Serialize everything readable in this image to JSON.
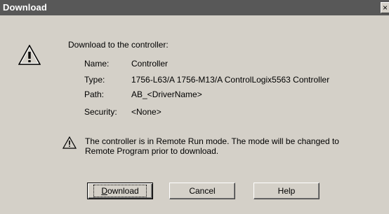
{
  "window": {
    "title": "Download",
    "close_glyph": "×"
  },
  "message": {
    "heading": "Download to the controller:",
    "name_label": "Name:",
    "name_value": "Controller",
    "type_label": "Type:",
    "type_value": "1756-L63/A 1756-M13/A ControlLogix5563 Controller",
    "path_label": "Path:",
    "path_value": "AB_<DriverName>",
    "security_label": "Security:",
    "security_value": "<None>",
    "warning_line1": "The controller is in Remote Run mode. The mode will be changed to",
    "warning_line2": "Remote Program prior to download."
  },
  "buttons": {
    "download_first": "D",
    "download_rest": "ownload",
    "cancel": "Cancel",
    "help": "Help"
  },
  "icons": {
    "large": "warning-triangle-icon",
    "small": "warning-triangle-icon"
  }
}
